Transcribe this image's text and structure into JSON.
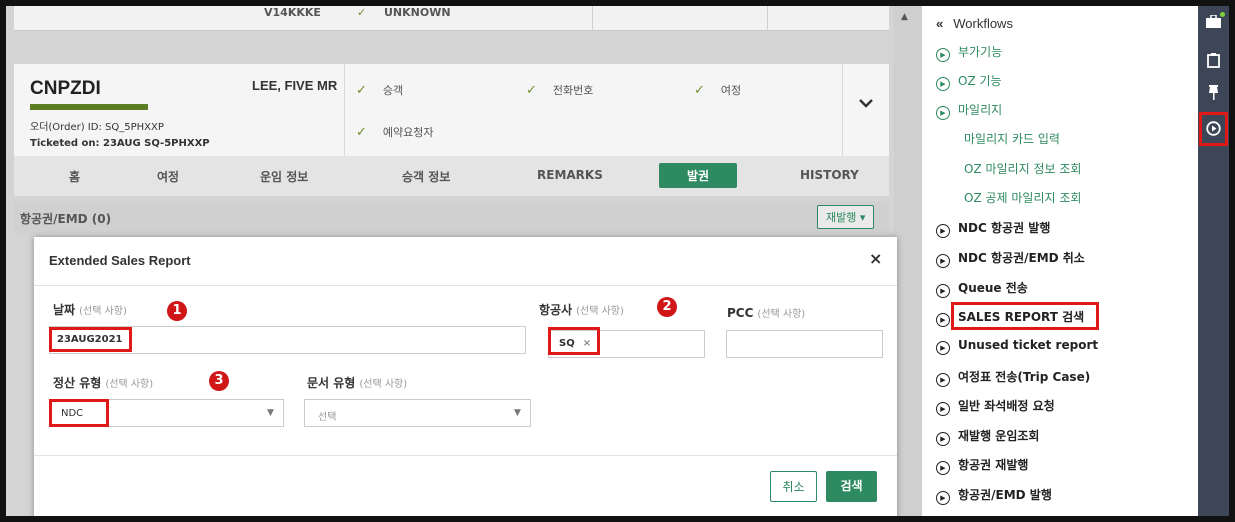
{
  "top_strip": {
    "col1": "V14KKKE",
    "col2": "UNKNOWN"
  },
  "booking": {
    "pnr": "CNPZDI",
    "passenger": "LEE, FIVE MR",
    "order_id": "오더(Order) ID:  SQ_5PHXXP",
    "ticketed_on": "Ticketed on: 23AUG   SQ-5PHXXP",
    "checks": [
      "승객",
      "전화번호",
      "여정",
      "예약요청자"
    ],
    "check_mark": "✓"
  },
  "tabs": [
    "홈",
    "여정",
    "운임 정보",
    "승객 정보",
    "REMARKS",
    "발권",
    "HISTORY"
  ],
  "active_tab_index": 5,
  "tickets_section": {
    "title": "항공권/EMD (0)",
    "reissue_label": "재발행 ▾"
  },
  "modal": {
    "title": "Extended Sales Report",
    "close": "×",
    "optional_text": "(선택 사항)",
    "date": {
      "label": "날짜",
      "value": "23AUG2021"
    },
    "airline": {
      "label": "항공사",
      "tag": "SQ",
      "tag_remove": "×"
    },
    "pcc": {
      "label": "PCC"
    },
    "settlement": {
      "label": "정산 유형",
      "value": "NDC"
    },
    "doc_type": {
      "label": "문서 유형",
      "placeholder": "선택"
    },
    "cancel_label": "취소",
    "search_label": "검색",
    "markers": [
      "1",
      "2",
      "3"
    ]
  },
  "panel": {
    "collapse_glyph": "«",
    "title": "Workflows",
    "items": [
      {
        "label": "부가기능",
        "green": true
      },
      {
        "label": "OZ 기능",
        "green": true,
        "bold_prefix": "OZ"
      },
      {
        "label": "마일리지",
        "green": true
      },
      {
        "label": "마일리지 카드 입력",
        "green": true,
        "sub": true
      },
      {
        "label": "OZ 마일리지 정보 조회",
        "green": true,
        "sub": true
      },
      {
        "label": "OZ 공제 마일리지 조회",
        "green": true,
        "sub": true
      },
      {
        "label": "NDC 항공권 발행"
      },
      {
        "label": "NDC 항공권/EMD 취소"
      },
      {
        "label": "Queue 전송"
      },
      {
        "label": "SALES REPORT 검색",
        "highlight": true
      },
      {
        "label": "Unused ticket report"
      },
      {
        "label": "여정표 전송(Trip Case)"
      },
      {
        "label": "일반 좌석배정 요청"
      },
      {
        "label": "재발행 운임조회"
      },
      {
        "label": "항공권 재발행"
      },
      {
        "label": "항공권/EMD 발행"
      }
    ]
  },
  "rail_icons": [
    "briefcase-icon",
    "clipboard-icon",
    "pin-icon",
    "play-circle-icon"
  ],
  "colors": {
    "accent": "#2e8a60",
    "highlight": "#e01818",
    "rail": "#3c4656"
  }
}
